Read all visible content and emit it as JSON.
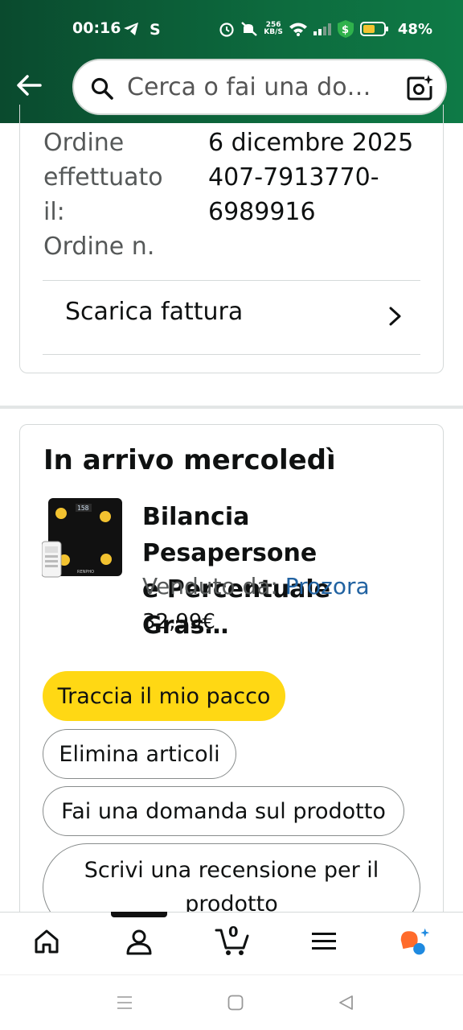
{
  "status_bar": {
    "time": "00:16",
    "network_speed_top": "256",
    "network_speed_bottom": "KB/S",
    "battery_percent": "48%",
    "icons": [
      "telegram-icon",
      "skype-icon",
      "alarm-icon",
      "mute-icon",
      "wifi-icon",
      "signal-icon",
      "vpn-shield-icon",
      "battery-icon"
    ]
  },
  "header": {
    "search_placeholder": "Cerca o fai una do…",
    "colors": {
      "header_bg": "#0a4a2e",
      "header_accent": "#0e7a46"
    }
  },
  "order_info": {
    "labels": [
      "Ordine",
      "effettuato",
      "il:",
      "Ordine n."
    ],
    "values": [
      "6 dicembre 2025",
      "407-7913770-",
      "6989916"
    ],
    "invoice_label": "Scarica fattura"
  },
  "shipment": {
    "arrival_title": "In arrivo mercoledì",
    "product_title_line1": "Bilancia Pesapersone",
    "product_title_line2": "e Percentuale Gras…",
    "seller_prefix": "Venduto da: ",
    "seller_name": "Prozora",
    "price": "32,99€",
    "buttons": {
      "track": "Traccia il mio pacco",
      "delete": "Elimina articoli",
      "question": "Fai una domanda sul prodotto",
      "review": "Scrivi una recensione per il prodotto"
    },
    "colors": {
      "primary_button": "#ffd814",
      "link": "#2162a1"
    }
  },
  "bottom_nav": {
    "cart_count": "0",
    "items": [
      "home-icon",
      "account-icon",
      "cart-icon",
      "menu-icon",
      "rufus-icon"
    ]
  }
}
